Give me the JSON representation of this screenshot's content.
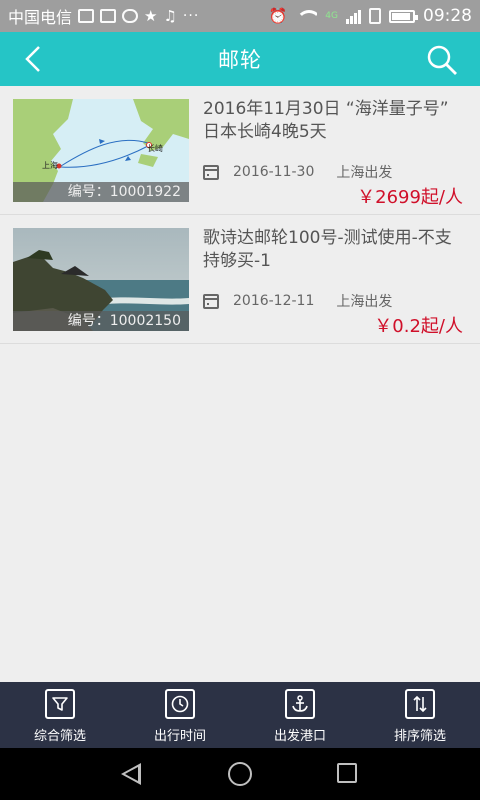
{
  "status_bar": {
    "carrier": "中国电信",
    "dots": "···",
    "network": "4G",
    "time": "09:28",
    "battery_fraction": 0.8
  },
  "app_bar": {
    "title": "邮轮",
    "back_icon": "chevron-left-icon",
    "search_icon": "search-icon"
  },
  "cruises": [
    {
      "title": "2016年11月30日 “海洋量子号” 日本长崎4晚5天",
      "code_label": "编号：",
      "code": "10001922",
      "date": "2016-11-30",
      "departure": "上海出发",
      "price": "￥2699起/人",
      "map_labels": {
        "from": "上海",
        "to": "长崎"
      }
    },
    {
      "title": "歌诗达邮轮100号-测试使用-不支持够买-1",
      "code_label": "编号：",
      "code": "10002150",
      "date": "2016-12-11",
      "departure": "上海出发",
      "price": "￥0.2起/人"
    }
  ],
  "tabs": [
    {
      "label": "综合筛选",
      "icon": "filter-icon"
    },
    {
      "label": "出行时间",
      "icon": "clock-icon"
    },
    {
      "label": "出发港口",
      "icon": "anchor-icon"
    },
    {
      "label": "排序筛选",
      "icon": "sort-icon"
    }
  ],
  "colors": {
    "accent": "#25c5c6",
    "price": "#d0102a",
    "tabbar": "#2c3245",
    "status_bar": "#9e9e9e"
  }
}
